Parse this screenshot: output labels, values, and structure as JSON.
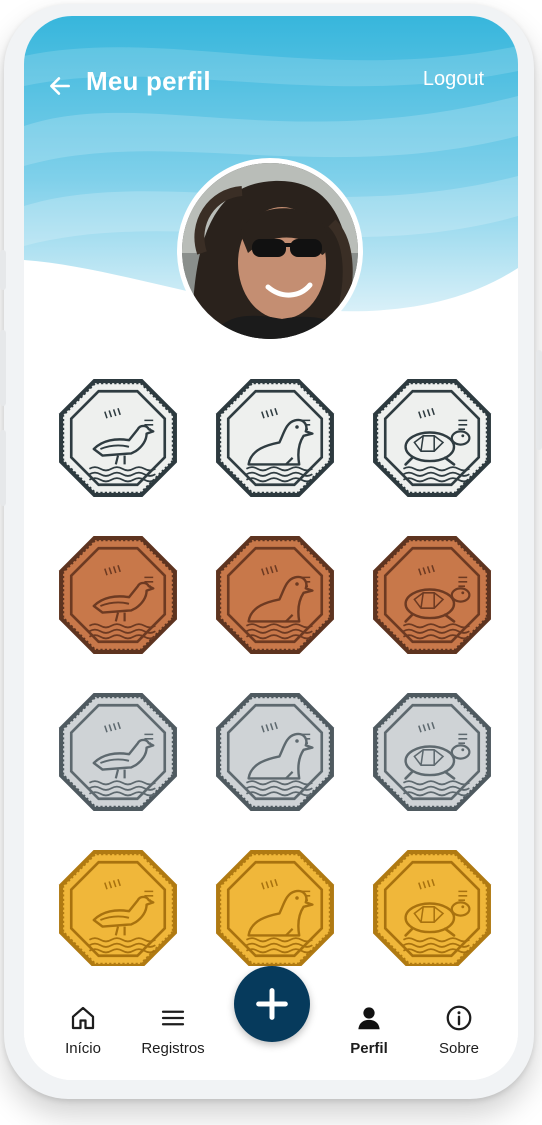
{
  "header": {
    "title": "Meu perfil",
    "logout_label": "Logout"
  },
  "colors": {
    "header_gradient_top": "#39b8dd",
    "header_gradient_bottom": "#d8eff7",
    "fab": "#063a5c",
    "nav_text": "#1d1d1d"
  },
  "badges": [
    {
      "tier": "outline",
      "animal": "seagull"
    },
    {
      "tier": "outline",
      "animal": "sea-lion"
    },
    {
      "tier": "outline",
      "animal": "turtle"
    },
    {
      "tier": "bronze",
      "animal": "seagull"
    },
    {
      "tier": "bronze",
      "animal": "sea-lion"
    },
    {
      "tier": "bronze",
      "animal": "turtle"
    },
    {
      "tier": "silver",
      "animal": "seagull"
    },
    {
      "tier": "silver",
      "animal": "sea-lion"
    },
    {
      "tier": "silver",
      "animal": "turtle"
    },
    {
      "tier": "gold",
      "animal": "seagull"
    },
    {
      "tier": "gold",
      "animal": "sea-lion"
    },
    {
      "tier": "gold",
      "animal": "turtle"
    }
  ],
  "tier_colors": {
    "outline": {
      "face": "#eef0ee",
      "border": "#2d3a3f",
      "line": "#2f3c41"
    },
    "bronze": {
      "face": "#c8784a",
      "border": "#5e3420",
      "line": "#6d3a22"
    },
    "silver": {
      "face": "#cfd3d6",
      "border": "#4f5a60",
      "line": "#5e696f"
    },
    "gold": {
      "face": "#f0b73a",
      "border": "#b07a12",
      "line": "#a8720f"
    }
  },
  "nav": {
    "items": [
      {
        "label": "Início",
        "icon": "home-icon"
      },
      {
        "label": "Registros",
        "icon": "list-icon"
      },
      {
        "label": "Perfil",
        "icon": "user-icon"
      },
      {
        "label": "Sobre",
        "icon": "info-icon"
      }
    ],
    "fab_icon": "plus-icon",
    "active": "Perfil"
  }
}
